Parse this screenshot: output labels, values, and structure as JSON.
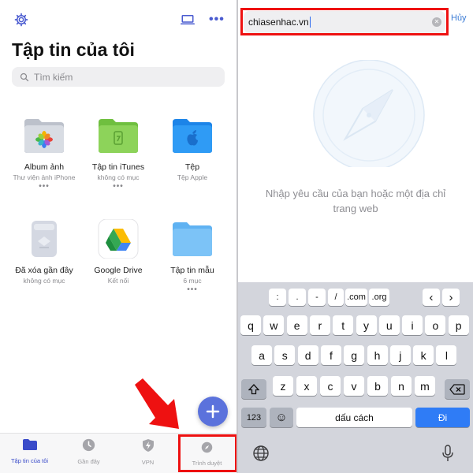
{
  "files_app": {
    "title": "Tập tin của tôi",
    "search_placeholder": "Tìm kiếm",
    "locations": [
      {
        "name": "Album ảnh",
        "subtitle": "Thư viện ảnh iPhone",
        "icon": "photos-folder-icon"
      },
      {
        "name": "Tập tin iTunes",
        "subtitle": "không có mục",
        "icon": "itunes-folder-icon"
      },
      {
        "name": "Tệp",
        "subtitle": "Tệp Apple",
        "icon": "apple-folder-icon"
      },
      {
        "name": "Đã xóa gần đây",
        "subtitle": "không có mục",
        "icon": "trash-icon"
      },
      {
        "name": "Google Drive",
        "subtitle": "Kết nối",
        "icon": "google-drive-icon"
      },
      {
        "name": "Tập tin mẫu",
        "subtitle": "6 mục",
        "icon": "folder-icon"
      }
    ],
    "more_glyph": "•••",
    "tabs": [
      {
        "label": "Tập tin của tôi",
        "icon": "folder-icon",
        "active": true
      },
      {
        "label": "Gần đây",
        "icon": "clock-icon",
        "active": false
      },
      {
        "label": "VPN",
        "icon": "shield-icon",
        "active": false
      },
      {
        "label": "Trình duyệt",
        "icon": "compass-icon",
        "active": false
      }
    ],
    "colors": {
      "accent": "#4a5bd0",
      "fab": "#5b72dc",
      "annotation": "#ee1111"
    }
  },
  "browser": {
    "url_value": "chiasenhac.vn",
    "cancel_label": "Hủy",
    "empty_message_line1": "Nhập yêu cầu của bạn hoặc một địa chỉ",
    "empty_message_line2": "trang web"
  },
  "keyboard": {
    "symbol_row": [
      ":",
      ".",
      "-",
      "/",
      ".com",
      ".org"
    ],
    "nav_keys": [
      "‹",
      "›"
    ],
    "row1": [
      "q",
      "w",
      "e",
      "r",
      "t",
      "y",
      "u",
      "i",
      "o",
      "p"
    ],
    "row2": [
      "a",
      "s",
      "d",
      "f",
      "g",
      "h",
      "j",
      "k",
      "l"
    ],
    "row3": [
      "z",
      "x",
      "c",
      "v",
      "b",
      "n",
      "m"
    ],
    "numbers_label": "123",
    "emoji_label": "☺",
    "space_label": "dấu cách",
    "go_label": "Đi"
  }
}
